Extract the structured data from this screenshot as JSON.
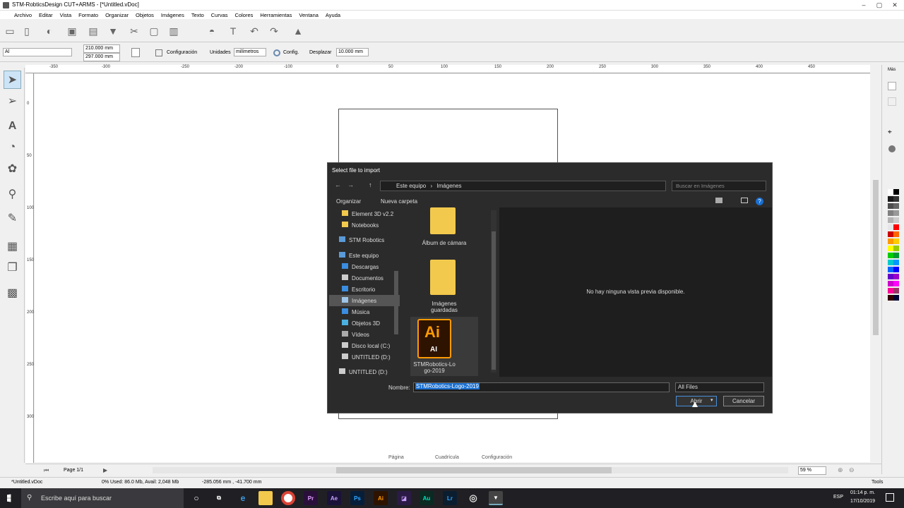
{
  "window": {
    "title": "STM-RobticsDesign CUT+ARMS - [*Untitled.vDoc]"
  },
  "menu": [
    "Archivo",
    "Editar",
    "Vista",
    "Formato",
    "Organizar",
    "Objetos",
    "Imágenes",
    "Texto",
    "Curvas",
    "Colores",
    "Herramientas",
    "Ventana",
    "Ayuda"
  ],
  "toolbar2": {
    "font": "Al",
    "width": "210.000 mm",
    "height": "297.000 mm",
    "config_label": "Configuración",
    "units_label": "Unidades",
    "units_value": "milímetros",
    "config2_label": "Config.",
    "nudge_label": "Desplazar",
    "nudge_value": "10.000 mm"
  },
  "ruler_h": [
    "-350",
    "-300",
    "-250",
    "-200",
    "-150",
    "-100",
    "-50",
    "0",
    "50",
    "100",
    "150",
    "200",
    "250",
    "300",
    "350",
    "400",
    "450"
  ],
  "ruler_v": [
    "0",
    "50",
    "100",
    "150",
    "200",
    "250",
    "300"
  ],
  "bottom": {
    "page": "Page 1/1",
    "tab1": "Página",
    "tab2": "Cuadrícula",
    "tab3": "Configuración",
    "zoom": "59 %"
  },
  "status": {
    "file": "*Untitled.vDoc",
    "memory": "0%  Used: 86.0 Mb, Avail: 2,048 Mb",
    "coords": "-285.056 mm , -41.700 mm",
    "tools": "Tools"
  },
  "right_panel": {
    "more": "Más"
  },
  "taskbar": {
    "search_placeholder": "Escribe aquí para buscar",
    "lang": "ESP",
    "time": "01:14 p. m.",
    "date": "17/10/2019",
    "apps": [
      "Pr",
      "Ae",
      "Ps",
      "Ai",
      "Lr",
      "Au"
    ]
  },
  "dialog": {
    "title": "Select file to import",
    "path": [
      "Este equipo",
      "Imágenes"
    ],
    "search_placeholder": "Buscar en Imágenes",
    "organize": "Organizar",
    "new_folder": "Nueva carpeta",
    "nav": [
      "Element 3D v2.2",
      "Notebooks",
      "STM Robotics",
      "Este equipo",
      "Descargas",
      "Documentos",
      "Escritorio",
      "Imágenes",
      "Música",
      "Objetos 3D",
      "Vídeos",
      "Disco local (C:)",
      "UNTITLED (D:)",
      "UNTITLED (D:)"
    ],
    "files": [
      {
        "name": "Álbum de cámara"
      },
      {
        "name": "Imágenes guardadas"
      },
      {
        "name": "STMRobotics-Logo-2019",
        "icon_text": "Ai",
        "icon_sub": "AI"
      }
    ],
    "preview_text": "No hay ninguna vista previa disponible.",
    "filename_label": "Nombre:",
    "filename": "STMRobotics-Logo-2019",
    "filetype": "All Files",
    "open": "Abrir",
    "cancel": "Cancelar"
  },
  "colors": {
    "accent": "#0078d7",
    "dialog_bg": "#2b2b2b"
  },
  "palette": [
    "#ffffff",
    "#000000",
    "#1a1a1a",
    "#333333",
    "#4d4d4d",
    "#666666",
    "#808080",
    "#999999",
    "#b3b3b3",
    "#cccccc",
    "#e6e6e6",
    "#ff0000",
    "#cc0000",
    "#ff6600",
    "#ff9900",
    "#ffcc00",
    "#ffff00",
    "#99cc00",
    "#00cc00",
    "#009933",
    "#00cccc",
    "#0099ff",
    "#0066ff",
    "#0000ff",
    "#6600cc",
    "#9900cc",
    "#cc00cc",
    "#ff00ff",
    "#ff0099",
    "#993366",
    "#330000",
    "#000033"
  ]
}
